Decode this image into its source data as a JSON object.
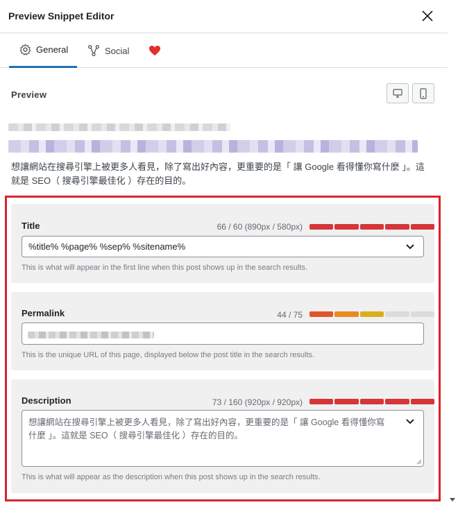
{
  "header": {
    "title": "Preview Snippet Editor"
  },
  "tabs": [
    {
      "label": "General",
      "icon": "gear-icon"
    },
    {
      "label": "Social",
      "icon": "share-icon"
    },
    {
      "label": "",
      "icon": "heart-icon"
    }
  ],
  "preview": {
    "heading": "Preview",
    "description": "想讓網站在搜尋引擎上被更多人看見，除了寫出好內容，更重要的是「 讓 Google 看得懂你寫什麼 」。這就是 SEO（ 搜尋引擎最佳化 ）存在的目的。"
  },
  "title_card": {
    "label": "Title",
    "count": "66 / 60 (890px / 580px)",
    "value": "%title% %page% %sep% %sitename%",
    "help": "This is what will appear in the first line when this post shows up in the search results.",
    "meter_color": "#d63638"
  },
  "permalink_card": {
    "label": "Permalink",
    "count": "44 / 75",
    "help": "This is the unique URL of this page, displayed below the post title in the search results."
  },
  "description_card": {
    "label": "Description",
    "count": "73 / 160 (920px / 920px)",
    "value": "想讓網站在搜尋引擎上被更多人看見，除了寫出好內容，更重要的是「 讓 Google 看得懂你寫什麼 」。這就是 SEO（ 搜尋引擎最佳化 ）存在的目的。",
    "help": "This is what will appear as the description when this post shows up in the search results."
  },
  "colors": {
    "accent": "#2271b1",
    "alert": "#d63638",
    "highlight_frame": "#d9232e",
    "heart": "#e0302e"
  }
}
